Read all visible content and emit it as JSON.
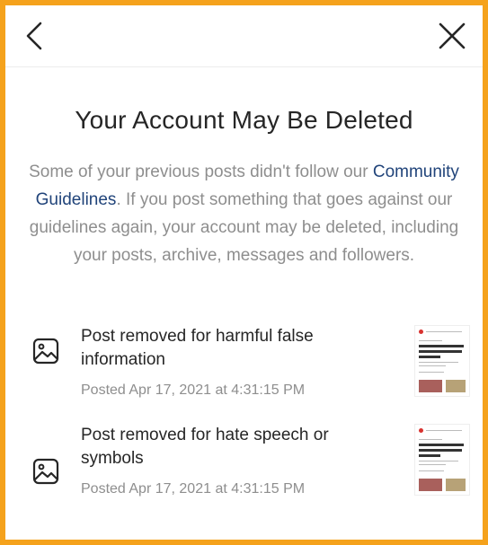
{
  "header": {
    "back_icon": "chevron-left-icon",
    "close_icon": "close-icon"
  },
  "main": {
    "title": "Your Account May Be Deleted",
    "message": {
      "before_link": "Some of your previous posts didn't follow our ",
      "link": "Community Guidelines",
      "after_link": ". If you post something that goes against our guidelines again, your account may be deleted, including your posts, archive, messages and followers."
    }
  },
  "posts": [
    {
      "icon": "image-icon",
      "title": "Post removed for harmful false information",
      "date": "Posted Apr 17, 2021 at 4:31:15 PM"
    },
    {
      "icon": "image-icon",
      "title": "Post removed for hate speech or symbols",
      "date": "Posted Apr 17, 2021 at 4:31:15 PM"
    }
  ],
  "colors": {
    "frame_border": "#f5a21c",
    "link": "#21447a",
    "title": "#262626",
    "muted": "#8e8e8e"
  }
}
